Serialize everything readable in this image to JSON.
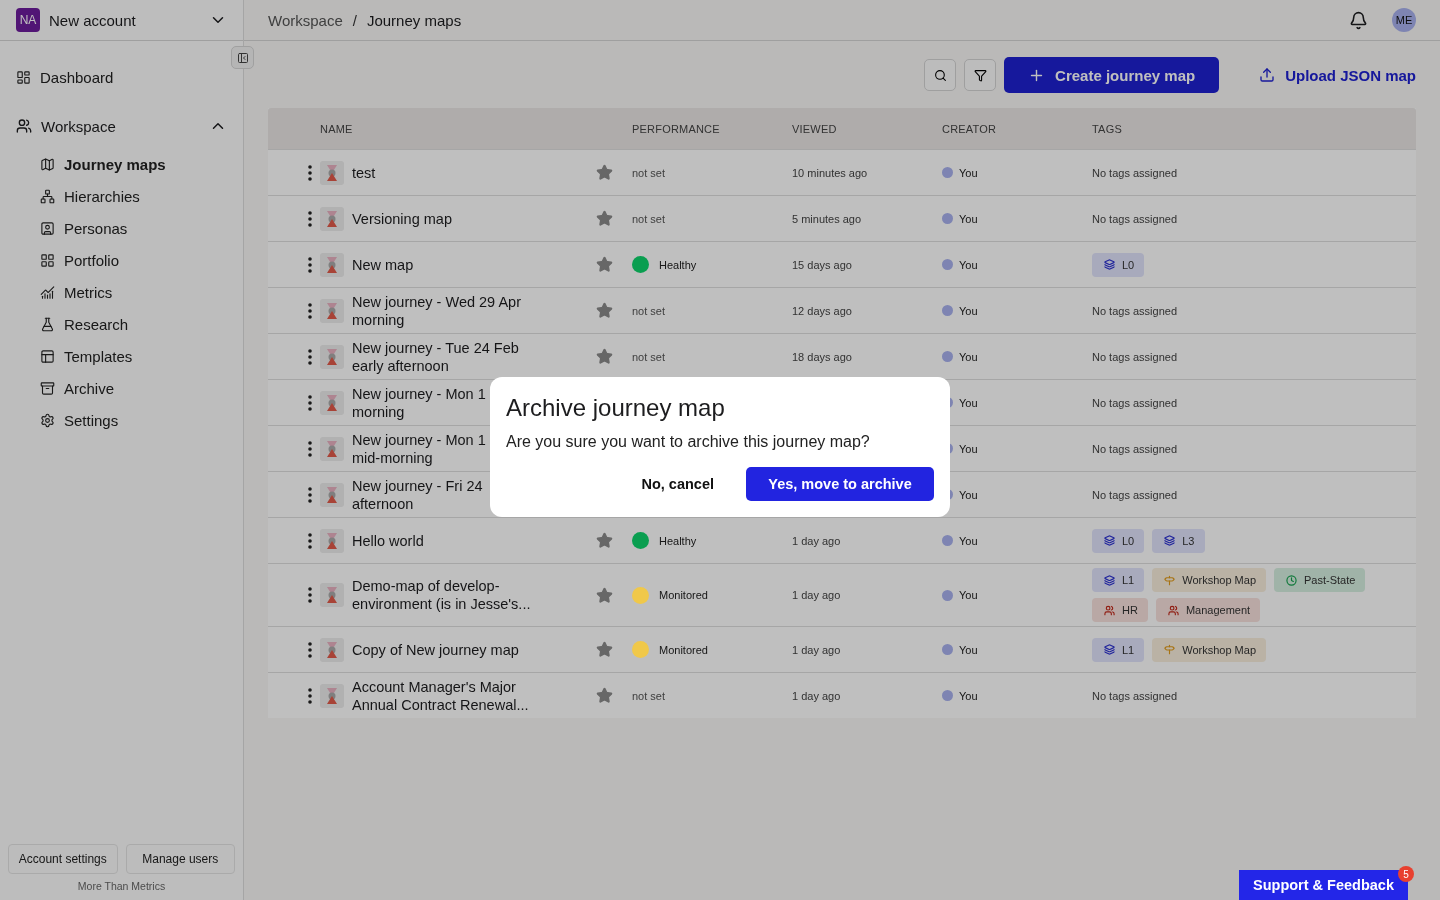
{
  "account": {
    "initials": "NA",
    "name": "New account"
  },
  "sidebar": {
    "items": [
      {
        "label": "Dashboard",
        "selected": false
      }
    ],
    "section": {
      "label": "Workspace",
      "expanded": true,
      "items": [
        {
          "label": "Journey maps",
          "selected": true
        },
        {
          "label": "Hierarchies",
          "selected": false
        },
        {
          "label": "Personas",
          "selected": false
        },
        {
          "label": "Portfolio",
          "selected": false
        },
        {
          "label": "Metrics",
          "selected": false
        },
        {
          "label": "Research",
          "selected": false
        },
        {
          "label": "Templates",
          "selected": false
        },
        {
          "label": "Archive",
          "selected": false
        },
        {
          "label": "Settings",
          "selected": false
        }
      ]
    },
    "footer_buttons": [
      "Account settings",
      "Manage users"
    ],
    "footer_text": "More Than Metrics"
  },
  "breadcrumb": {
    "items": [
      "Workspace",
      "Journey maps"
    ],
    "separator": "/"
  },
  "user": {
    "initials": "ME"
  },
  "toolbar": {
    "create_label": "Create journey map",
    "upload_label": "Upload JSON map"
  },
  "table": {
    "columns": [
      "NAME",
      "PERFORMANCE",
      "VIEWED",
      "CREATOR",
      "TAGS"
    ],
    "rows": [
      {
        "name": "test",
        "performance": {
          "label": "not set"
        },
        "viewed": "10 minutes ago",
        "creator": "You",
        "tags": [],
        "no_tags": "No tags assigned"
      },
      {
        "name": "Versioning map",
        "performance": {
          "label": "not set"
        },
        "viewed": "5 minutes ago",
        "creator": "You",
        "tags": [],
        "no_tags": "No tags assigned"
      },
      {
        "name": "New map",
        "performance": {
          "label": "Healthy",
          "color": "#0a9e50"
        },
        "viewed": "15 days ago",
        "creator": "You",
        "tags": [
          {
            "kind": "level",
            "label": "L0"
          }
        ]
      },
      {
        "name": "New journey - Wed 29 Apr\nmorning",
        "performance": {
          "label": "not set"
        },
        "viewed": "12 days ago",
        "creator": "You",
        "tags": [],
        "no_tags": "No tags assigned"
      },
      {
        "name": "New journey - Tue 24 Feb\nearly afternoon",
        "performance": {
          "label": "not set"
        },
        "viewed": "18 days ago",
        "creator": "You",
        "tags": [],
        "no_tags": "No tags assigned"
      },
      {
        "name": "New journey - Mon 1\nmorning",
        "creator": "You",
        "tags": [],
        "no_tags": "No tags assigned"
      },
      {
        "name": "New journey - Mon 1\nmid-morning",
        "creator": "You",
        "tags": [],
        "no_tags": "No tags assigned"
      },
      {
        "name": "New journey - Fri 24\nafternoon",
        "creator": "You",
        "tags": [],
        "no_tags": "No tags assigned"
      },
      {
        "name": "Hello world",
        "performance": {
          "label": "Healthy",
          "color": "#0a9e50"
        },
        "viewed": "1 day ago",
        "creator": "You",
        "tags": [
          {
            "kind": "level",
            "label": "L0"
          },
          {
            "kind": "level",
            "label": "L3"
          }
        ]
      },
      {
        "name": "Demo-map of develop-\nenvironment (is in Jesse's...",
        "performance": {
          "label": "Monitored",
          "color": "#f0c84a"
        },
        "viewed": "1 day ago",
        "creator": "You",
        "tags": [
          {
            "kind": "level",
            "label": "L1"
          },
          {
            "kind": "workshop",
            "label": "Workshop Map"
          },
          {
            "kind": "state",
            "label": "Past-State"
          },
          {
            "kind": "team",
            "label": "HR"
          },
          {
            "kind": "team",
            "label": "Management"
          }
        ]
      },
      {
        "name": "Copy of New journey map",
        "performance": {
          "label": "Monitored",
          "color": "#f0c84a"
        },
        "viewed": "1 day ago",
        "creator": "You",
        "tags": [
          {
            "kind": "level",
            "label": "L1"
          },
          {
            "kind": "workshop",
            "label": "Workshop Map"
          }
        ]
      },
      {
        "name": "Account Manager's Major\nAnnual Contract Renewal...",
        "performance": {
          "label": "not set"
        },
        "viewed": "1 day ago",
        "creator": "You",
        "tags": [],
        "no_tags": "No tags assigned"
      }
    ]
  },
  "dialog": {
    "title": "Archive journey map",
    "message": "Are you sure you want to archive this journey map?",
    "cancel": "No, cancel",
    "confirm": "Yes, move to archive"
  },
  "support": {
    "label": "Support & Feedback",
    "badge": "5"
  }
}
